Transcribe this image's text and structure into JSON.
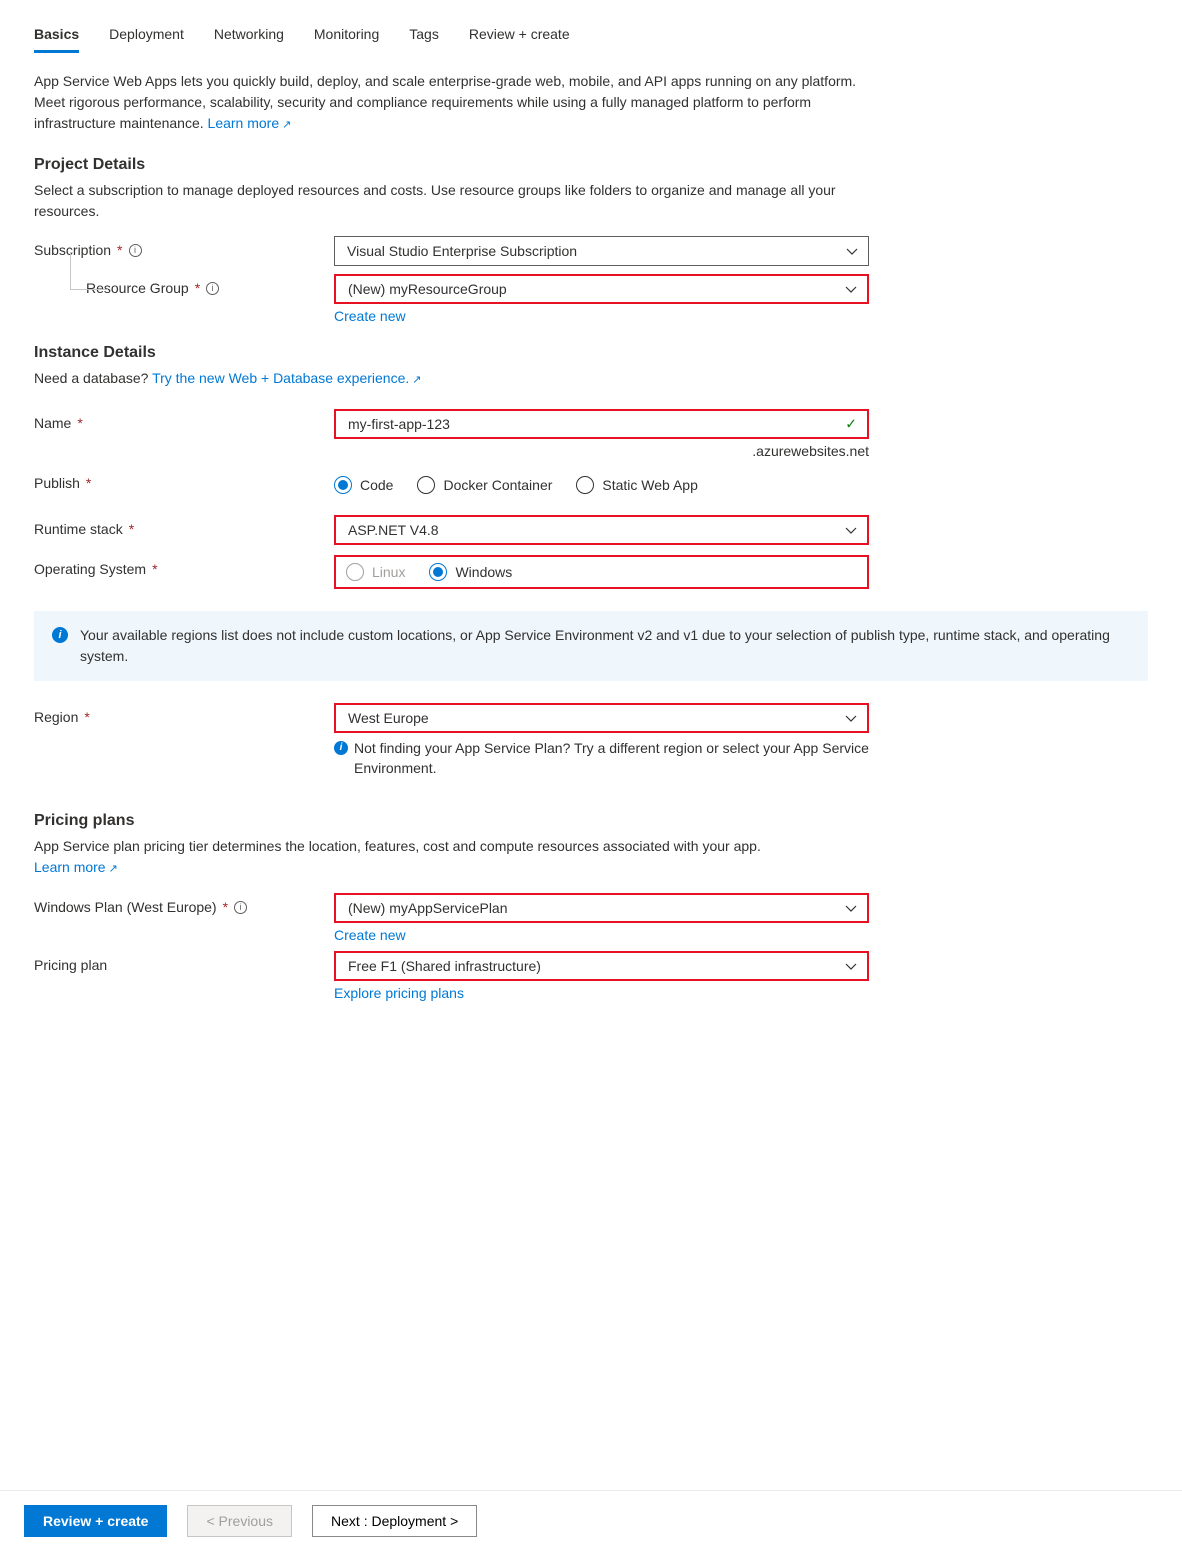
{
  "tabs": [
    "Basics",
    "Deployment",
    "Networking",
    "Monitoring",
    "Tags",
    "Review + create"
  ],
  "active_tab": 0,
  "intro_text": "App Service Web Apps lets you quickly build, deploy, and scale enterprise-grade web, mobile, and API apps running on any platform. Meet rigorous performance, scalability, security and compliance requirements while using a fully managed platform to perform infrastructure maintenance.  ",
  "learn_more": "Learn more",
  "project_details": {
    "heading": "Project Details",
    "desc": "Select a subscription to manage deployed resources and costs. Use resource groups like folders to organize and manage all your resources.",
    "subscription_label": "Subscription",
    "subscription_value": "Visual Studio Enterprise Subscription",
    "resource_group_label": "Resource Group",
    "resource_group_value": "(New) myResourceGroup",
    "create_new": "Create new"
  },
  "instance_details": {
    "heading": "Instance Details",
    "db_prompt": "Need a database? ",
    "db_link": "Try the new Web + Database experience.",
    "name_label": "Name",
    "name_value": "my-first-app-123",
    "name_suffix": ".azurewebsites.net",
    "publish_label": "Publish",
    "publish_options": [
      "Code",
      "Docker Container",
      "Static Web App"
    ],
    "publish_selected": 0,
    "runtime_label": "Runtime stack",
    "runtime_value": "ASP.NET V4.8",
    "os_label": "Operating System",
    "os_options": [
      "Linux",
      "Windows"
    ],
    "os_selected": 1,
    "os_disabled": [
      true,
      false
    ],
    "info_box": "Your available regions list does not include custom locations, or App Service Environment v2 and v1 due to your selection of publish type, runtime stack, and operating system.",
    "region_label": "Region",
    "region_value": "West Europe",
    "region_helper": "Not finding your App Service Plan? Try a different region or select your App Service Environment."
  },
  "pricing": {
    "heading": "Pricing plans",
    "desc": "App Service plan pricing tier determines the location, features, cost and compute resources associated with your app.",
    "learn_more": "Learn more",
    "plan_label": "Windows Plan (West Europe)",
    "plan_value": "(New) myAppServicePlan",
    "create_new": "Create new",
    "tier_label": "Pricing plan",
    "tier_value": "Free F1 (Shared infrastructure)",
    "explore": "Explore pricing plans"
  },
  "footer": {
    "review": "Review + create",
    "previous": "< Previous",
    "next": "Next : Deployment >"
  }
}
